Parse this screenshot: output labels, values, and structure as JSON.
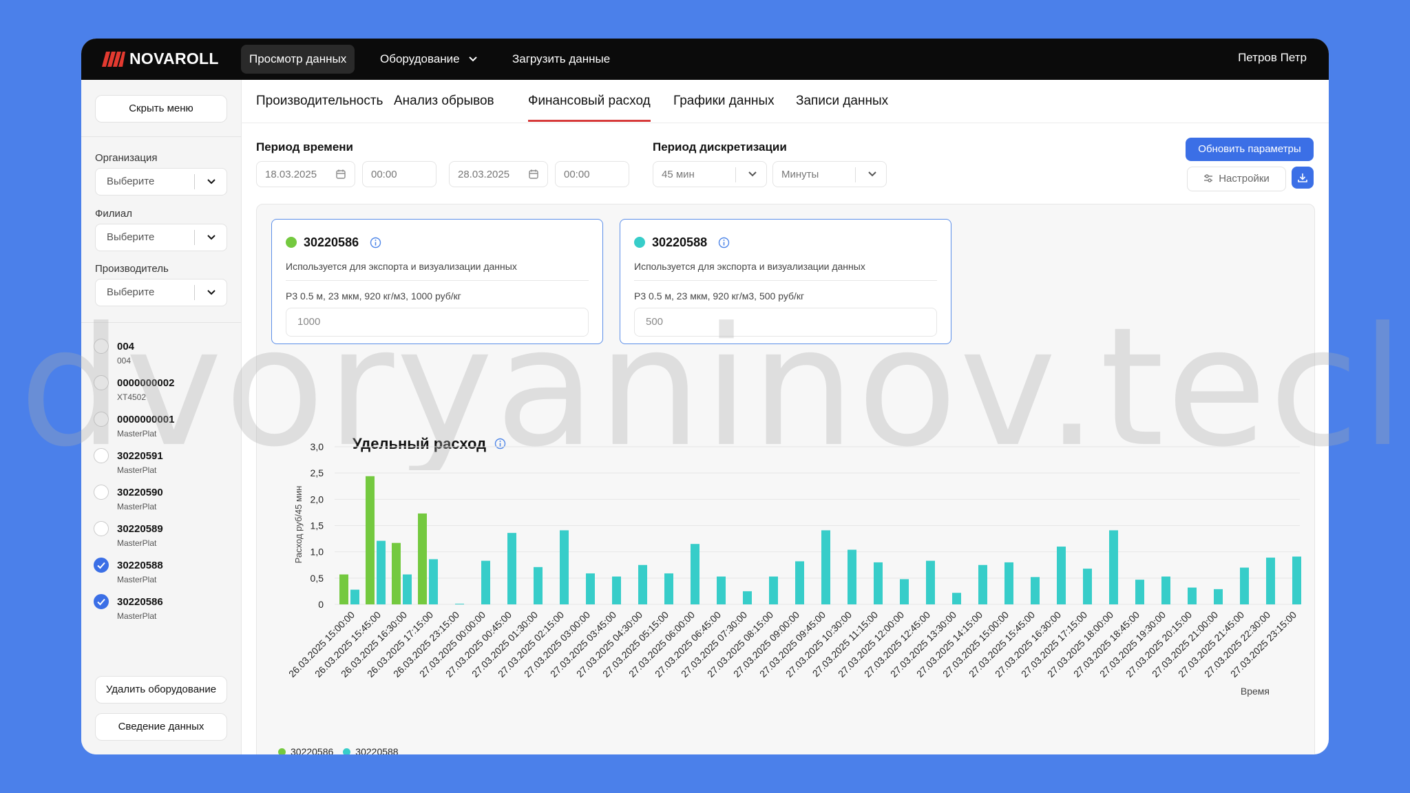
{
  "app": {
    "logo_text": "NOVAROLL",
    "nav": [
      {
        "label": "Просмотр данных"
      },
      {
        "label": "Оборудование"
      },
      {
        "label": "Загрузить данные"
      }
    ],
    "user": "Петров Петр"
  },
  "sidebar": {
    "hide_menu": "Скрыть меню",
    "filters": [
      {
        "label": "Организация",
        "placeholder": "Выберите"
      },
      {
        "label": "Филиал",
        "placeholder": "Выберите"
      },
      {
        "label": "Производитель",
        "placeholder": "Выберите"
      }
    ],
    "equipment": [
      {
        "title": "004",
        "sub": "004",
        "checked": false
      },
      {
        "title": "0000000002",
        "sub": "XT4502",
        "checked": false
      },
      {
        "title": "0000000001",
        "sub": "MasterPlat",
        "checked": false
      },
      {
        "title": "30220591",
        "sub": "MasterPlat",
        "checked": false
      },
      {
        "title": "30220590",
        "sub": "MasterPlat",
        "checked": false
      },
      {
        "title": "30220589",
        "sub": "MasterPlat",
        "checked": false
      },
      {
        "title": "30220588",
        "sub": "MasterPlat",
        "checked": true
      },
      {
        "title": "30220586",
        "sub": "MasterPlat",
        "checked": true
      }
    ],
    "delete_button": "Удалить оборудование",
    "merge_button": "Сведение данных"
  },
  "tabs": [
    {
      "label": "Производительность"
    },
    {
      "label": "Анализ обрывов"
    },
    {
      "label": "Финансовый расход",
      "active": true
    },
    {
      "label": "Графики данных"
    },
    {
      "label": "Записи данных"
    }
  ],
  "filters": {
    "period_label": "Период времени",
    "date_from": "18.03.2025",
    "time_from": "00:00",
    "date_to": "28.03.2025",
    "time_to": "00:00",
    "discretization_label": "Период дискретизации",
    "interval": "45 мин",
    "unit": "Минуты",
    "update_button": "Обновить параметры",
    "settings_button": "Настройки"
  },
  "cards": [
    {
      "id": "30220586",
      "desc": "Используется для экспорта и визуализации данных",
      "spec": "P3 0.5 м, 23 мкм, 920 кг/м3, 1000 руб/кг",
      "value": "1000",
      "color": "#74c93f"
    },
    {
      "id": "30220588",
      "desc": "Используется для экспорта и визуализации данных",
      "spec": "P3 0.5 м, 23 мкм, 920 кг/м3, 500 руб/кг",
      "value": "500",
      "color": "#37cdc9"
    }
  ],
  "section_title": "Удельный расход",
  "watermark": "dvoryaninov.tech",
  "chart_data": {
    "type": "bar",
    "ylabel": "Расход руб/45 мин",
    "xlabel": "Время",
    "ylim": [
      0,
      3.0
    ],
    "yticks": [
      "0",
      "0,5",
      "1,0",
      "1,5",
      "2,0",
      "2,5",
      "3,0"
    ],
    "grid": true,
    "legend": "bottom-left",
    "categories": [
      "26.03.2025 15:00:00",
      "26.03.2025 15:45:00",
      "26.03.2025 16:30:00",
      "26.03.2025 17:15:00",
      "26.03.2025 23:15:00",
      "27.03.2025 00:00:00",
      "27.03.2025 00:45:00",
      "27.03.2025 01:30:00",
      "27.03.2025 02:15:00",
      "27.03.2025 03:00:00",
      "27.03.2025 03:45:00",
      "27.03.2025 04:30:00",
      "27.03.2025 05:15:00",
      "27.03.2025 06:00:00",
      "27.03.2025 06:45:00",
      "27.03.2025 07:30:00",
      "27.03.2025 08:15:00",
      "27.03.2025 09:00:00",
      "27.03.2025 09:45:00",
      "27.03.2025 10:30:00",
      "27.03.2025 11:15:00",
      "27.03.2025 12:00:00",
      "27.03.2025 12:45:00",
      "27.03.2025 13:30:00",
      "27.03.2025 14:15:00",
      "27.03.2025 15:00:00",
      "27.03.2025 15:45:00",
      "27.03.2025 16:30:00",
      "27.03.2025 17:15:00",
      "27.03.2025 18:00:00",
      "27.03.2025 18:45:00",
      "27.03.2025 19:30:00",
      "27.03.2025 20:15:00",
      "27.03.2025 21:00:00",
      "27.03.2025 21:45:00",
      "27.03.2025 22:30:00",
      "27.03.2025 23:15:00"
    ],
    "series": [
      {
        "name": "30220586",
        "color": "#74c93f",
        "values": [
          0.57,
          2.44,
          1.17,
          1.73,
          0,
          0,
          0,
          0,
          0,
          0,
          0,
          0,
          0,
          0,
          0,
          0,
          0,
          0,
          0,
          0,
          0,
          0,
          0,
          0,
          0,
          0,
          0,
          0,
          0,
          0,
          0,
          0,
          0,
          0,
          0,
          0,
          0
        ]
      },
      {
        "name": "30220588",
        "color": "#37cdc9",
        "values": [
          0.28,
          1.21,
          0.57,
          0.86,
          0.01,
          0.83,
          1.36,
          0.71,
          1.41,
          0.59,
          0.53,
          0.75,
          0.59,
          1.15,
          0.53,
          0.25,
          0.53,
          0.82,
          1.41,
          1.04,
          0.8,
          0.48,
          0.83,
          0.22,
          0.75,
          0.8,
          0.52,
          1.1,
          0.68,
          1.41,
          0.47,
          0.53,
          0.32,
          0.29,
          0.7,
          0.89,
          0.91
        ]
      }
    ]
  }
}
